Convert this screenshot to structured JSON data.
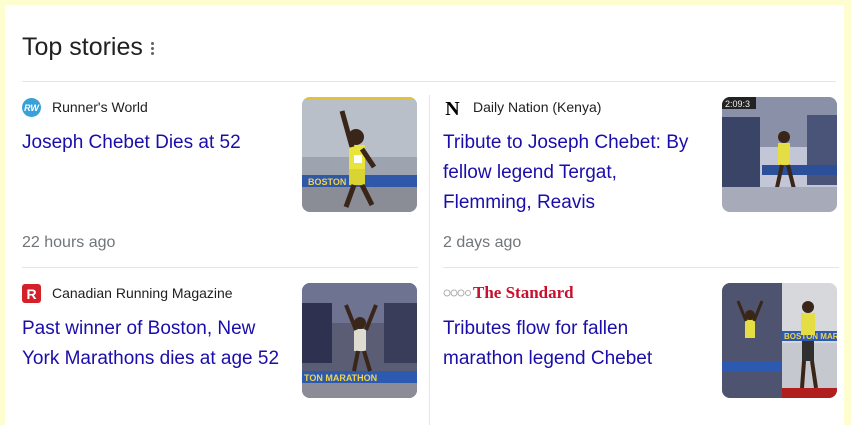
{
  "header": {
    "title": "Top stories"
  },
  "stories": [
    {
      "source": "Runner's World",
      "source_icon": "runners-world-logo-icon",
      "icon_text": "RW",
      "headline": "Joseph Chebet Dies at 52",
      "time": "22 hours ago"
    },
    {
      "source": "Daily Nation (Kenya)",
      "source_icon": "daily-nation-logo-icon",
      "icon_text": "N",
      "headline": "Tribute to Joseph Chebet: By fellow legend Tergat, Flemming, Reavis",
      "time": "2 days ago"
    },
    {
      "source": "Canadian Running Magazine",
      "source_icon": "canadian-running-logo-icon",
      "icon_text": "R",
      "headline": "Past winner of Boston, New York Marathons dies at age 52",
      "time": ""
    },
    {
      "source": "The Standard",
      "source_icon": "the-standard-logo-icon",
      "icon_text": "The Standard",
      "headline": "Tributes flow for fallen marathon legend Chebet",
      "time": ""
    }
  ],
  "colors": {
    "page_background": "#fdfdcf",
    "headline_link": "#1a0dab",
    "meta_text": "#70757a",
    "runners_world": "#3aa0d8",
    "canadian_running": "#d4202b",
    "the_standard": "#c8102e"
  }
}
